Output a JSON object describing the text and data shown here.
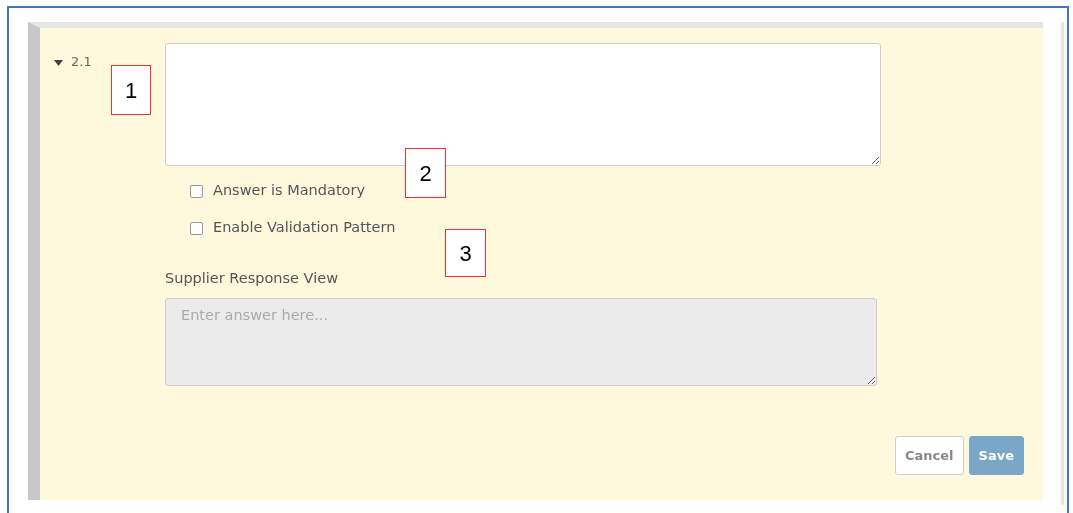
{
  "question": {
    "number": "2.1",
    "expanded": true
  },
  "options": [
    {
      "label": "Answer is Mandatory",
      "checked": false
    },
    {
      "label": "Enable Validation Pattern",
      "checked": false
    }
  ],
  "response_view": {
    "label": "Supplier Response View",
    "placeholder": "Enter answer here...",
    "disabled": true
  },
  "buttons": [
    {
      "label": "Cancel",
      "kind": "secondary",
      "disabled": false
    },
    {
      "label": "Save",
      "kind": "primary",
      "disabled": true
    }
  ],
  "callouts": [
    {
      "label": "1"
    },
    {
      "label": "2"
    },
    {
      "label": "3"
    }
  ]
}
